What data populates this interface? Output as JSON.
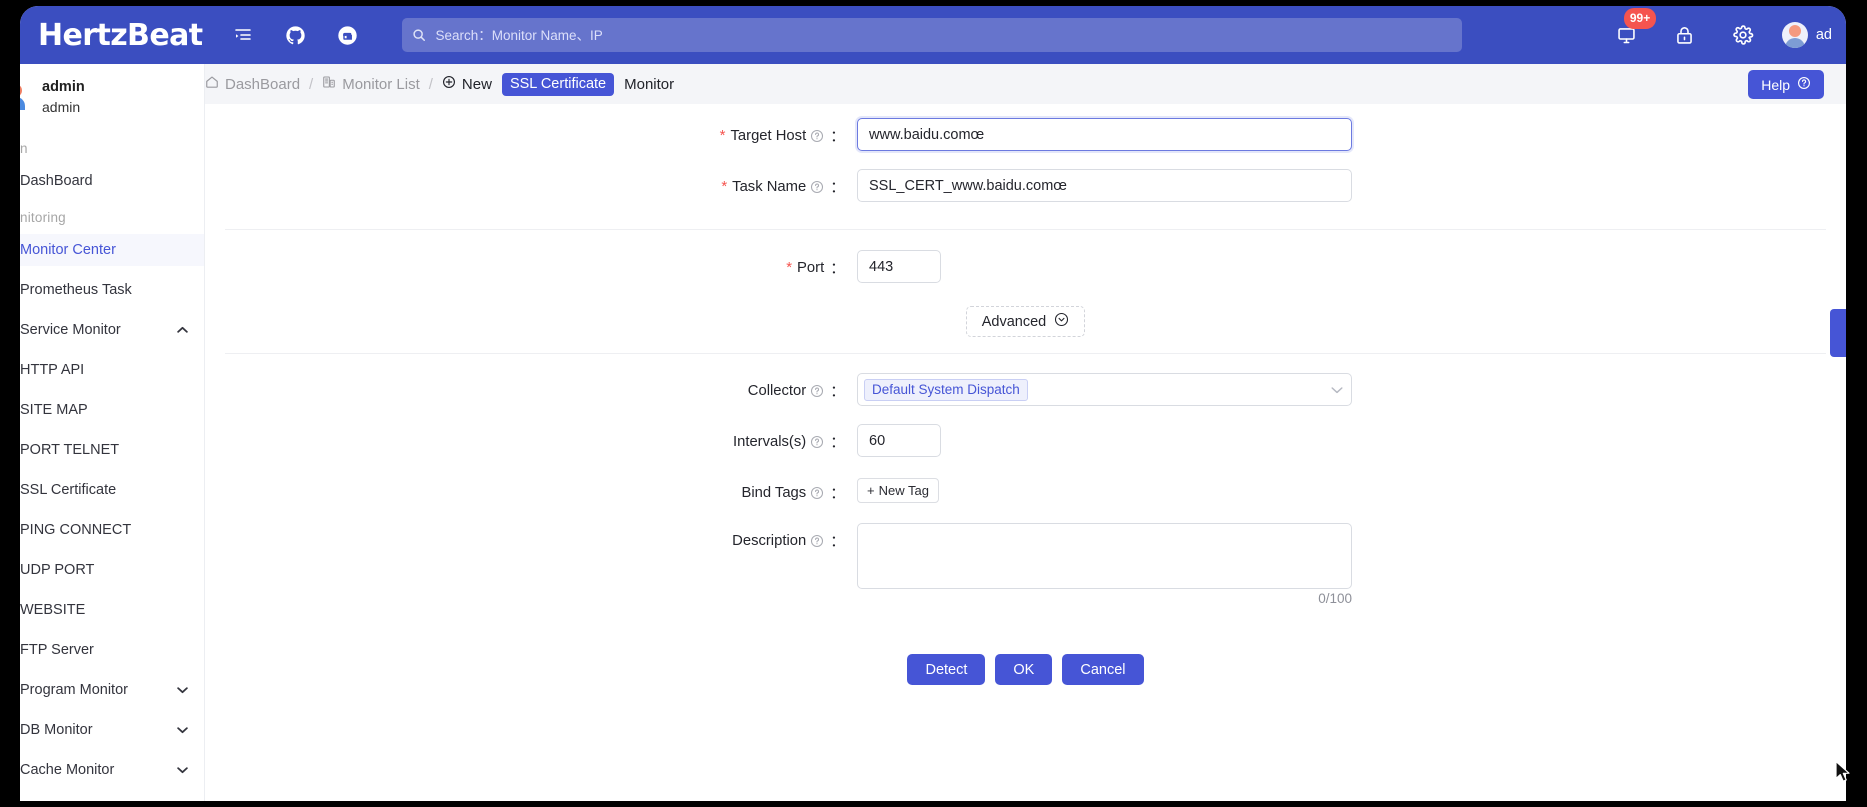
{
  "header": {
    "logo": "HertzBeat",
    "icons": [
      {
        "name": "menu-fold-icon",
        "glyph": "menu"
      },
      {
        "name": "github-icon",
        "glyph": "github"
      },
      {
        "name": "gitee-icon",
        "glyph": "gitee"
      }
    ],
    "search": {
      "placeholder": "Search：Monitor Name、IP",
      "value": "",
      "icon": "search-icon"
    },
    "notification_badge": "99+",
    "right_icons": [
      {
        "name": "notification-bell-icon"
      },
      {
        "name": "lock-icon"
      },
      {
        "name": "settings-gear-icon"
      }
    ],
    "username": "ad"
  },
  "sidebar": {
    "profile": {
      "name": "admin",
      "role": "admin"
    },
    "groups": [
      {
        "title": "n",
        "items": [
          {
            "label": "DashBoard",
            "active": false,
            "expandable": false
          }
        ]
      },
      {
        "title": "nitoring",
        "items": [
          {
            "label": "Monitor Center",
            "active": true,
            "expandable": false
          },
          {
            "label": "Prometheus Task",
            "active": false,
            "expandable": false
          },
          {
            "label": "Service Monitor",
            "active": false,
            "expandable": true,
            "expanded": true
          },
          {
            "label": "HTTP API",
            "active": false,
            "expandable": false
          },
          {
            "label": "SITE MAP",
            "active": false,
            "expandable": false
          },
          {
            "label": "PORT TELNET",
            "active": false,
            "expandable": false
          },
          {
            "label": "SSL Certificate",
            "active": false,
            "expandable": false
          },
          {
            "label": "PING CONNECT",
            "active": false,
            "expandable": false
          },
          {
            "label": "UDP PORT",
            "active": false,
            "expandable": false
          },
          {
            "label": "WEBSITE",
            "active": false,
            "expandable": false
          },
          {
            "label": "FTP Server",
            "active": false,
            "expandable": false
          },
          {
            "label": "Program Monitor",
            "active": false,
            "expandable": true,
            "expanded": false
          },
          {
            "label": "DB Monitor",
            "active": false,
            "expandable": true,
            "expanded": false
          },
          {
            "label": "Cache Monitor",
            "active": false,
            "expandable": true,
            "expanded": false
          }
        ]
      }
    ]
  },
  "breadcrumb": {
    "dashboard": "DashBoard",
    "monitor_list": "Monitor List",
    "separator": "/",
    "new": "New",
    "type_tag": "SSL Certificate",
    "tail": "Monitor"
  },
  "help_button": {
    "label": "Help"
  },
  "form": {
    "target_host": {
      "label": "Target Host",
      "required": true,
      "value": "www.baidu.comœ",
      "focused": true
    },
    "task_name": {
      "label": "Task Name",
      "required": true,
      "value": "SSL_CERT_www.baidu.comœ",
      "focused": false
    },
    "port": {
      "label": "Port",
      "required": true,
      "value": "443",
      "has_help": false
    },
    "advanced": {
      "label": "Advanced"
    },
    "collector": {
      "label": "Collector",
      "value": "Default System Dispatch"
    },
    "intervals": {
      "label": "Intervals(s)",
      "value": "60"
    },
    "bind_tags": {
      "label": "Bind Tags",
      "new_tag_label": "New Tag",
      "new_tag_plus": "+"
    },
    "description": {
      "label": "Description",
      "value": "",
      "counter": "0/100"
    },
    "colon": "：",
    "actions": [
      {
        "label": "Detect",
        "name": "detect-button"
      },
      {
        "label": "OK",
        "name": "ok-button"
      },
      {
        "label": "Cancel",
        "name": "cancel-button"
      }
    ]
  },
  "colors": {
    "brand": "#4655d6",
    "header": "#3b4ec0",
    "badge": "#f5544f",
    "accent_tag_text": "#4655d6"
  }
}
